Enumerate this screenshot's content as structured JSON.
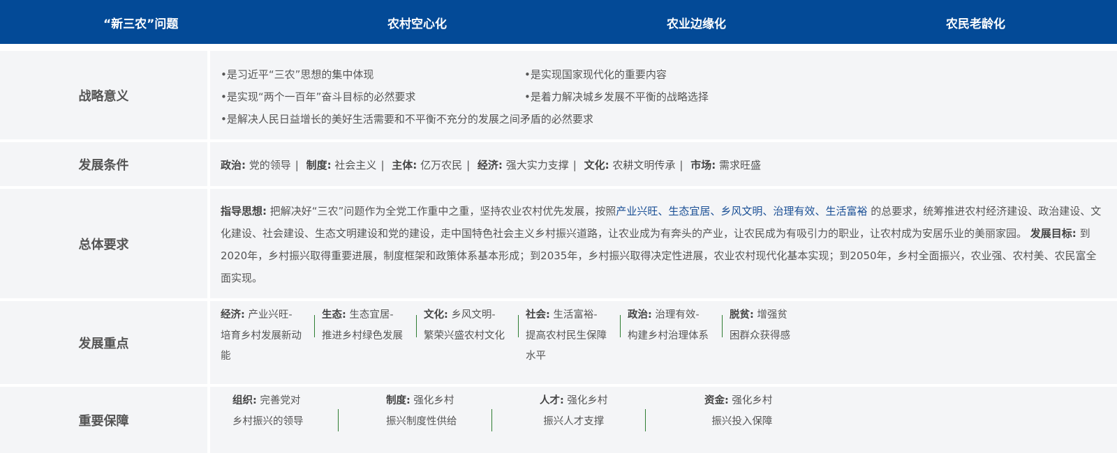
{
  "header": {
    "col1": "“新三农”问题",
    "col2": "农村空心化",
    "col3": "农业边缘化",
    "col4": "农民老龄化"
  },
  "rows": {
    "strategy": {
      "label": "战略意义",
      "items": [
        "•是习近平“三农”思想的集中体现",
        "•是实现国家现代化的重要内容",
        "•是实现“两个一百年”奋斗目标的必然要求",
        "•是着力解决城乡发展不平衡的战略选择",
        "•是解决人民日益增长的美好生活需要和不平衡不充分的发展之间矛盾的必然要求"
      ]
    },
    "conditions": {
      "label": "发展条件",
      "items": [
        {
          "k": "政治:",
          "v": "党的领导"
        },
        {
          "k": "制度:",
          "v": "社会主义"
        },
        {
          "k": "主体:",
          "v": "亿万农民"
        },
        {
          "k": "经济:",
          "v": "强大实力支撑"
        },
        {
          "k": "文化:",
          "v": "农耕文明传承"
        },
        {
          "k": "市场:",
          "v": "需求旺盛"
        }
      ]
    },
    "requirements": {
      "label": "总体要求",
      "guide_label": "指导思想:",
      "guide_pre": "把解决好“三农”问题作为全党工作重中之重，坚持农业农村优先发展，按照",
      "hl": [
        "产业兴旺",
        "生态宜居",
        "乡风文明",
        "治理有效",
        "生活富裕"
      ],
      "sep": "、",
      "guide_post": " 的总要求，统筹推进农村经济建设、政治建设、文化建设、社会建设、生态文明建设和党的建设，走中国特色社会主义乡村振兴道路，让农业成为有奔头的产业，让农民成为有吸引力的职业，让农村成为安居乐业的美丽家园。",
      "goal_label": "发展目标:",
      "goal_text": "到2020年，乡村振兴取得重要进展，制度框架和政策体系基本形成；到2035年，乡村振兴取得决定性进展，农业农村现代化基本实现；到2050年，乡村全面振兴，农业强、农村美、农民富全面实现。"
    },
    "focus": {
      "label": "发展重点",
      "items": [
        {
          "k": "经济:",
          "lines": [
            "产业兴旺-",
            "培育乡村发展新动",
            "能"
          ]
        },
        {
          "k": "生态:",
          "lines": [
            "生态宜居-",
            "推进乡村绿色发展"
          ]
        },
        {
          "k": "文化:",
          "lines": [
            "乡风文明-",
            "繁荣兴盛农村文化"
          ]
        },
        {
          "k": "社会:",
          "lines": [
            "生活富裕-",
            "提高农村民生保障",
            "水平"
          ]
        },
        {
          "k": "政治:",
          "lines": [
            "治理有效-",
            "构建乡村治理体系"
          ]
        },
        {
          "k": "脱贫:",
          "lines": [
            "增强贫",
            "困群众获得感"
          ]
        }
      ]
    },
    "guarantee": {
      "label": "重要保障",
      "items": [
        {
          "k": "组织:",
          "v1": "完善党对",
          "v2": "乡村振兴的领导"
        },
        {
          "k": "制度:",
          "v1": "强化乡村",
          "v2": "振兴制度性供给"
        },
        {
          "k": "人才:",
          "v1": "强化乡村",
          "v2": "振兴人才支撑"
        },
        {
          "k": "资金:",
          "v1": "强化乡村",
          "v2": "振兴投入保障"
        }
      ]
    }
  },
  "colors": {
    "header_bg": "#034a97",
    "row_bg": "#f4f5f7",
    "highlight": "#1a4f95",
    "divider": "#2e7d32"
  }
}
